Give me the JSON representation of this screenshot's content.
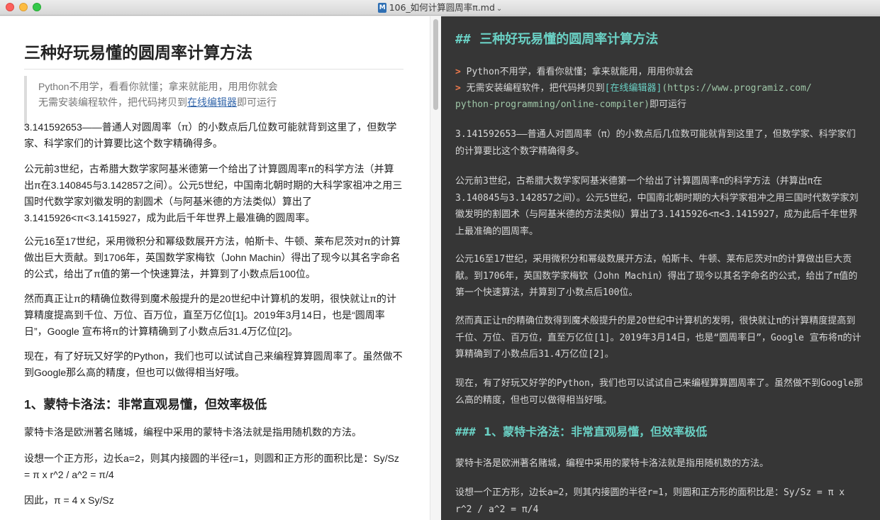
{
  "window": {
    "title": "106_如何计算圆周率π.md",
    "title_chevron": "⌄"
  },
  "preview": {
    "h2": "三种好玩易懂的圆周率计算方法",
    "quote_line1": "Python不用学，看看你就懂；拿来就能用，用用你就会",
    "quote_line2_before": "无需安装编程软件，把代码拷贝到",
    "quote_link": "在线编辑器",
    "quote_line2_after": "即可运行",
    "para1": "3.141592653——普通人对圆周率（π）的小数点后几位数可能就背到这里了，但数学家、科学家们的计算要比这个数字精确得多。",
    "para2": "公元前3世纪，古希腊大数学家阿基米德第一个给出了计算圆周率π的科学方法（并算出π在3.140845与3.142857之间）。公元5世纪，中国南北朝时期的大科学家祖冲之用三国时代数学家刘徽发明的割圆术（与阿基米德的方法类似）算出了3.1415926<π<3.1415927，成为此后千年世界上最准确的圆周率。",
    "para3": "公元16至17世纪，采用微积分和幂级数展开方法，帕斯卡、牛顿、莱布尼茨对π的计算做出巨大贡献。到1706年，英国数学家梅钦（John Machin）得出了现今以其名字命名的公式，给出了π值的第一个快速算法，并算到了小数点后100位。",
    "para4": "然而真正让π的精确位数得到魔术般提升的是20世纪中计算机的发明，很快就让π的计算精度提高到千位、万位、百万位，直至万亿位[1]。2019年3月14日，也是“圆周率日”，Google 宣布将π的计算精确到了小数点后31.4万亿位[2]。",
    "para5": "现在，有了好玩又好学的Python，我们也可以试试自己来编程算算圆周率了。虽然做不到Google那么高的精度，但也可以做得相当好哦。",
    "h3": "1、蒙特卡洛法：非常直观易懂，但效率极低",
    "para6": "蒙特卡洛是欧洲著名赌城，编程中采用的蒙特卡洛法就是指用随机数的方法。",
    "para7": "设想一个正方形，边长a=2，则其内接圆的半径r=1，则圆和正方形的面积比是：Sy/Sz = π x r^2 / a^2 = π/4",
    "para8": "因此，π = 4 x Sy/Sz"
  },
  "editor": {
    "h2_marker": "##",
    "h2_text": "三种好玩易懂的圆周率计算方法",
    "quote_marker": ">",
    "quote1": "Python不用学，看看你就懂；拿来就能用，用用你就会",
    "quote2_before": "无需安装编程软件，把代码拷贝到",
    "quote2_link": "[在线编辑器]",
    "quote2_url_a": "(https://www.programiz.com/",
    "quote2_url_b": "python-programming/online-compiler)",
    "quote2_after": "即可运行",
    "para1": "3.141592653——普通人对圆周率（π）的小数点后几位数可能就背到这里了，但数学家、科学家们的计算要比这个数字精确得多。",
    "para2": "公元前3世纪，古希腊大数学家阿基米德第一个给出了计算圆周率π的科学方法（并算出π在3.140845与3.142857之间）。公元5世纪，中国南北朝时期的大科学家祖冲之用三国时代数学家刘徽发明的割圆术（与阿基米德的方法类似）算出了3.1415926<π<3.1415927，成为此后千年世界上最准确的圆周率。",
    "para3": "公元16至17世纪，采用微积分和幂级数展开方法，帕斯卡、牛顿、莱布尼茨对π的计算做出巨大贡献。到1706年，英国数学家梅钦（John Machin）得出了现今以其名字命名的公式，给出了π值的第一个快速算法，并算到了小数点后100位。",
    "para4": "然而真正让π的精确位数得到魔术般提升的是20世纪中计算机的发明，很快就让π的计算精度提高到千位、万位、百万位，直至万亿位[1]。2019年3月14日，也是“圆周率日”，Google 宣布将π的计算精确到了小数点后31.4万亿位[2]。",
    "para5": "现在，有了好玩又好学的Python，我们也可以试试自己来编程算算圆周率了。虽然做不到Google那么高的精度，但也可以做得相当好哦。",
    "h3_marker": "###",
    "h3_text": "1、蒙特卡洛法：非常直观易懂，但效率极低",
    "para6": "蒙特卡洛是欧洲著名赌城，编程中采用的蒙特卡洛法就是指用随机数的方法。",
    "para7": "设想一个正方形，边长a=2，则其内接圆的半径r=1，则圆和正方形的面积比是：Sy/Sz = π x r^2 / a^2 = π/4"
  },
  "colors": {
    "editor_bg": "#363636",
    "heading_teal": "#6ad0c4",
    "quote_marker_orange": "#f07a4c",
    "preview_link": "#3366aa"
  },
  "icons": [
    "markdown-file-icon",
    "chevron-down-icon"
  ]
}
